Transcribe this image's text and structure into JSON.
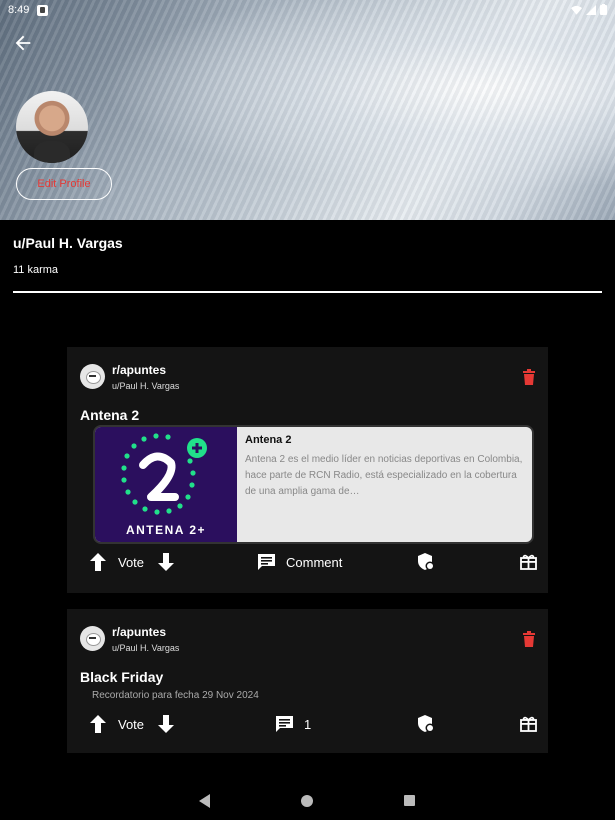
{
  "status_bar": {
    "time": "8:49"
  },
  "profile": {
    "edit_label": "Edit Profile",
    "username": "u/Paul H. Vargas",
    "karma": "11 karma"
  },
  "posts": [
    {
      "subreddit": "r/apuntes",
      "author": "u/Paul H. Vargas",
      "title": "Antena 2",
      "link": {
        "title": "Antena 2",
        "description": "Antena 2 es el medio líder en noticias deportivas en Colombia, hace parte de RCN Radio, está especializado en la cobertura de una amplia gama de…",
        "logo_text": "ANTENA 2+"
      },
      "vote_label": "Vote",
      "comment_label": "Comment"
    },
    {
      "subreddit": "r/apuntes",
      "author": "u/Paul H. Vargas",
      "title": "Black Friday",
      "subtitle": "Recordatorio para fecha 29 Nov 2024",
      "vote_label": "Vote",
      "comment_count": "1"
    }
  ],
  "colors": {
    "danger": "#e53935",
    "accent": "#21e08a",
    "card_bg": "#141414"
  }
}
